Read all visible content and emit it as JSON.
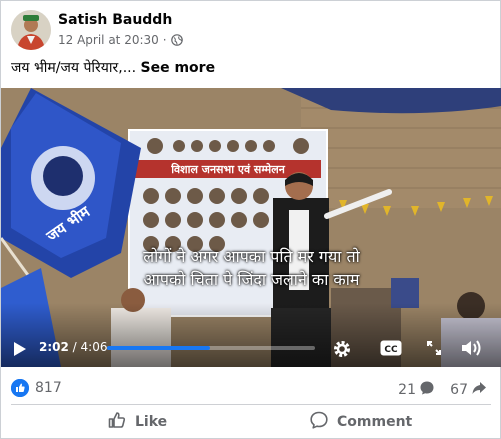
{
  "post": {
    "author": "Satish Bauddh",
    "timestamp": "12 April at 20:30",
    "separator": "·",
    "audience_icon": "globe-icon",
    "text": "जय भीम/जय पेरियार,...",
    "see_more": "See more"
  },
  "video": {
    "subtitle_line1": "लोगों ने अगर आपका पति मर गया तो",
    "subtitle_line2": "आपको चिता पे जिंदा जलाने का काम",
    "current_time": "2:02",
    "time_separator": " / ",
    "duration": "4:06",
    "progress": 0.496,
    "banner_title": "विशाल जनसभा एवं सम्मेलन",
    "flag_text": "जय भीम",
    "icons": [
      "play-icon",
      "settings-icon",
      "captions-icon",
      "fullscreen-icon",
      "volume-icon"
    ],
    "cc_label": "CC"
  },
  "stats": {
    "likes": "817",
    "comments": "21",
    "shares": "67"
  },
  "actions": {
    "like_label": "Like",
    "comment_label": "Comment"
  },
  "colors": {
    "facebook_blue": "#1877f2",
    "secondary_text": "#65676b",
    "divider": "#ced0d4"
  }
}
